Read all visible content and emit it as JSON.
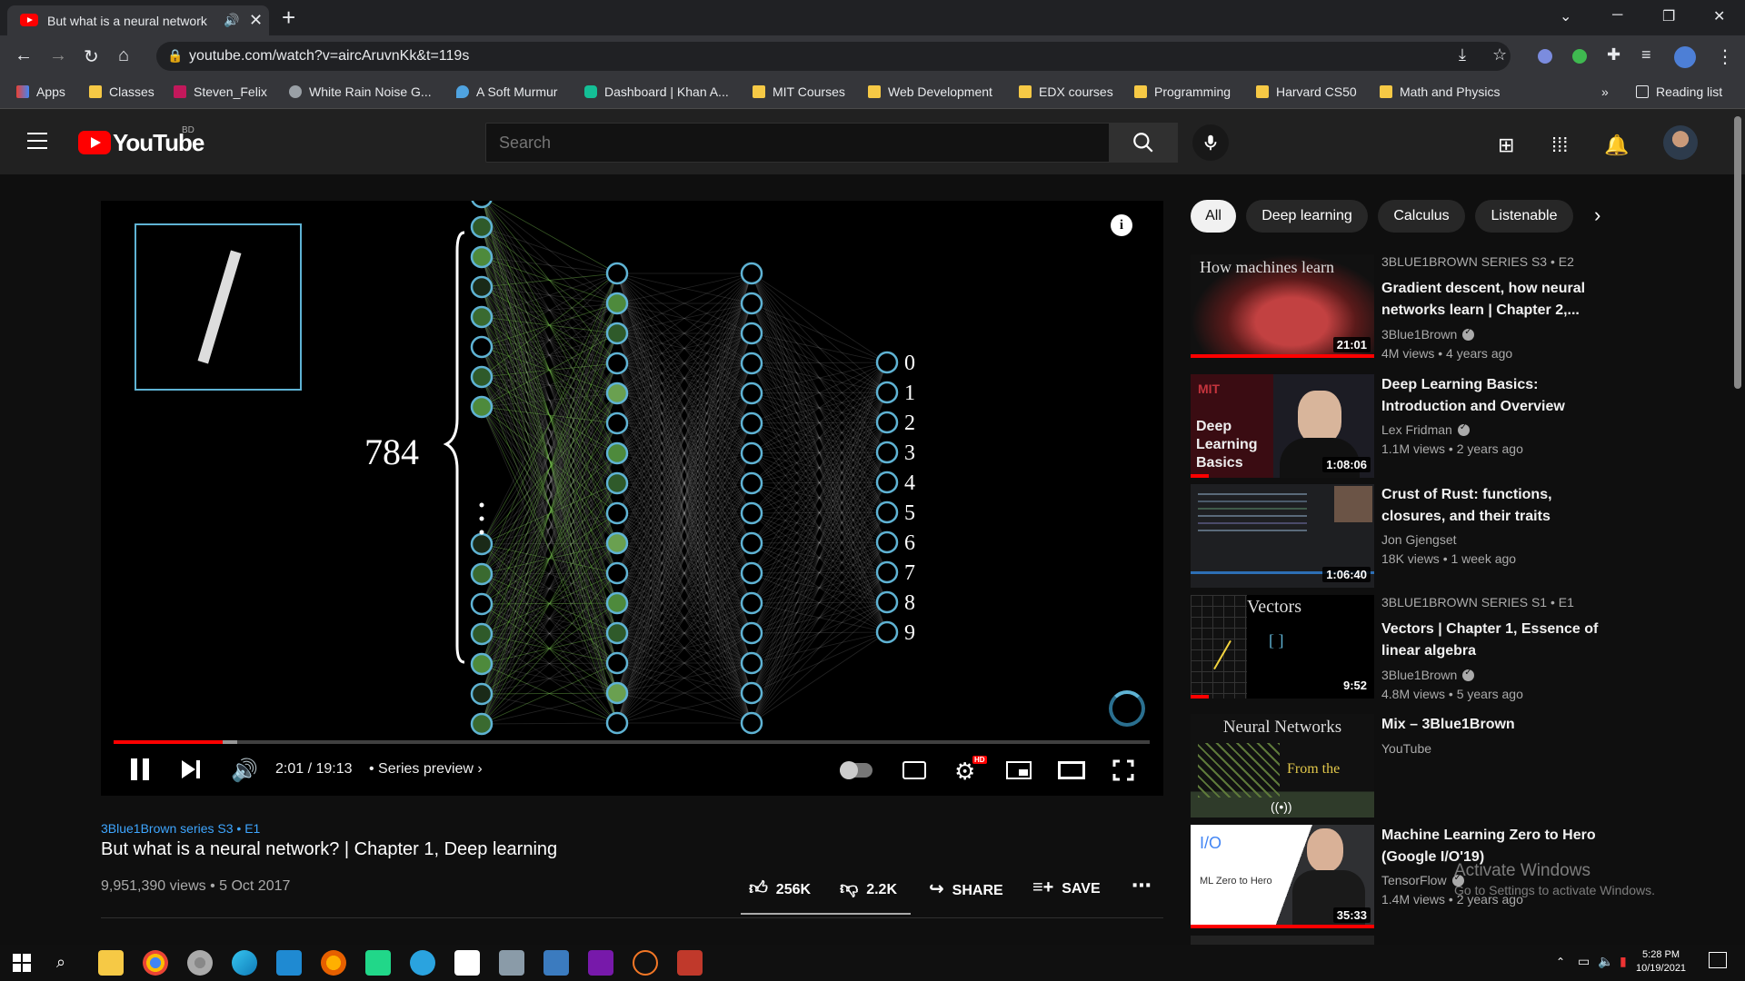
{
  "browser": {
    "tab_title": "But what is a neural network",
    "url": "youtube.com/watch?v=aircAruvnKk&t=119s",
    "bookmarks": [
      {
        "label": "Apps",
        "color": "#e94235"
      },
      {
        "label": "Classes",
        "color": "#f6c945"
      },
      {
        "label": "Steven_Felix",
        "color": "#c2185b"
      },
      {
        "label": "White Rain Noise G...",
        "color": "#9aa0a6"
      },
      {
        "label": "A Soft Murmur",
        "color": "#4fa3e0"
      },
      {
        "label": "Dashboard | Khan A...",
        "color": "#14bf96"
      },
      {
        "label": "MIT Courses",
        "color": "#f6c945"
      },
      {
        "label": "Web Development",
        "color": "#f6c945"
      },
      {
        "label": "EDX courses",
        "color": "#f6c945"
      },
      {
        "label": "Programming",
        "color": "#f6c945"
      },
      {
        "label": "Harvard CS50",
        "color": "#f6c945"
      },
      {
        "label": "Math and Physics",
        "color": "#f6c945"
      }
    ],
    "reading_list": "Reading list"
  },
  "youtube": {
    "wordmark": "YouTube",
    "country": "BD",
    "search_placeholder": "Search"
  },
  "player": {
    "input_count": "784",
    "output_labels": [
      "0",
      "1",
      "2",
      "3",
      "4",
      "5",
      "6",
      "7",
      "8",
      "9"
    ],
    "time": "2:01 / 19:13",
    "series_preview": "• Series preview",
    "progress_played": 0.105,
    "accent_color": "#5fb3d4"
  },
  "video": {
    "series": "3Blue1Brown series  S3 • E1",
    "title": "But what is a neural network? | Chapter 1, Deep learning",
    "meta": "9,951,390 views • 5 Oct 2017",
    "likes": "256K",
    "dislikes": "2.2K",
    "share": "SHARE",
    "save": "SAVE"
  },
  "chips": [
    "All",
    "Deep learning",
    "Calculus",
    "Listenable"
  ],
  "recommendations": [
    {
      "series": "3BLUE1BROWN SERIES  S3 • E2",
      "title": "Gradient descent, how neural networks learn | Chapter 2,...",
      "channel": "3Blue1Brown",
      "verified": true,
      "meta": "4M views • 4 years ago",
      "duration": "21:01",
      "thumb_text": "How machines learn"
    },
    {
      "series": "",
      "title": "Deep Learning Basics: Introduction and Overview",
      "channel": "Lex Fridman",
      "verified": true,
      "meta": "1.1M views • 2 years ago",
      "duration": "1:08:06",
      "thumb_text": "Deep Learning Basics"
    },
    {
      "series": "",
      "title": "Crust of Rust: functions, closures, and their traits",
      "channel": "Jon Gjengset",
      "verified": false,
      "meta": "18K views • 1 week ago",
      "duration": "1:06:40",
      "thumb_text": ""
    },
    {
      "series": "3BLUE1BROWN SERIES  S1 • E1",
      "title": "Vectors | Chapter 1, Essence of linear algebra",
      "channel": "3Blue1Brown",
      "verified": true,
      "meta": "4.8M views • 5 years ago",
      "duration": "9:52",
      "thumb_text": "Vectors"
    },
    {
      "series": "",
      "title": "Mix – 3Blue1Brown",
      "channel": "YouTube",
      "verified": false,
      "meta": "",
      "duration": "",
      "thumb_text": "Neural Networks"
    },
    {
      "series": "",
      "title": "Machine Learning Zero to Hero (Google I/O'19)",
      "channel": "TensorFlow",
      "verified": true,
      "meta": "1.4M views • 2 years ago",
      "duration": "35:33",
      "thumb_text": "ML Zero to Hero"
    }
  ],
  "windows": {
    "activate_title": "Activate Windows",
    "activate_sub": "Go to Settings to activate Windows.",
    "time": "5:28 PM",
    "date": "10/19/2021"
  }
}
